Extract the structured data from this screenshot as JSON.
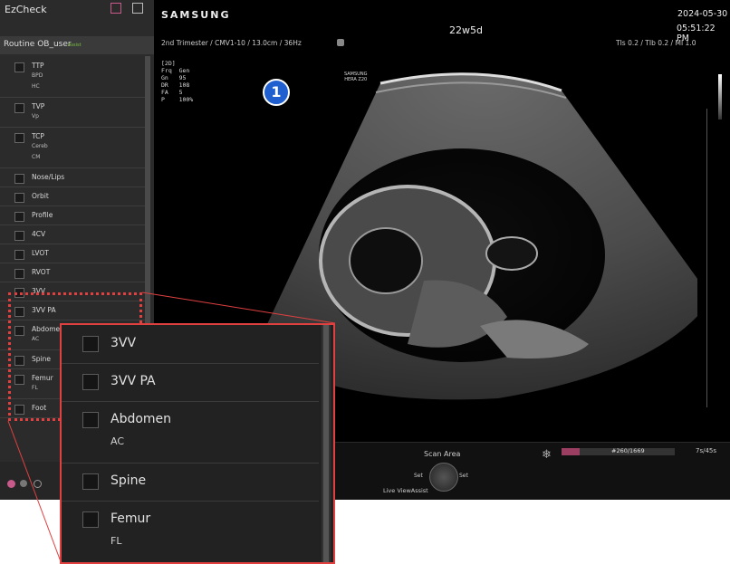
{
  "ezcheck": {
    "title": "EzCheck",
    "routine": "Routine OB_user",
    "routine_badge": "Assist",
    "items": [
      {
        "label": "TTP",
        "subs": [
          "BPD",
          "HC"
        ]
      },
      {
        "label": "TVP",
        "subs": [
          "Vp"
        ]
      },
      {
        "label": "TCP",
        "subs": [
          "Cereb",
          "CM"
        ]
      },
      {
        "label": "Nose/Lips",
        "subs": []
      },
      {
        "label": "Orbit",
        "subs": []
      },
      {
        "label": "Profile",
        "subs": []
      },
      {
        "label": "4CV",
        "subs": []
      },
      {
        "label": "LVOT",
        "subs": []
      },
      {
        "label": "RVOT",
        "subs": []
      },
      {
        "label": "3VV",
        "subs": []
      },
      {
        "label": "3VV PA",
        "subs": []
      },
      {
        "label": "Abdomen",
        "subs": [
          "AC"
        ]
      },
      {
        "label": "Spine",
        "subs": []
      },
      {
        "label": "Femur",
        "subs": [
          "FL"
        ]
      },
      {
        "label": "Foot",
        "subs": []
      }
    ]
  },
  "header": {
    "brand": "SAMSUNG",
    "ga": "22w5d",
    "date": "2024-05-30",
    "time": "05:51:22 PM",
    "preset": "2nd Trimester / CMV1-10 / 13.0cm / 36Hz",
    "indices": "TIs 0.2 / TIb 0.2 / MI 1.0"
  },
  "image_params": {
    "lines": [
      "[2D]",
      "Frq  Gen",
      "Gn   95",
      "DR   108",
      "FA   5",
      "P    100%"
    ],
    "watermark_line1": "SAMSUNG",
    "watermark_line2": "HERA Z20",
    "marker": "1"
  },
  "bottom": {
    "scan_area_title": "Scan Area",
    "set_left": "Set",
    "set_right": "Set",
    "live_label": "Live ViewAssist",
    "cine_frame": "#260/1669",
    "cine_time": "7s/45s"
  },
  "zoom": {
    "items": [
      {
        "label": "3VV",
        "subs": []
      },
      {
        "label": "3VV PA",
        "subs": []
      },
      {
        "label": "Abdomen",
        "subs": [
          "AC"
        ]
      },
      {
        "label": "Spine",
        "subs": []
      },
      {
        "label": "Femur",
        "subs": [
          "FL"
        ]
      }
    ]
  },
  "colors": {
    "highlight": "#e04040",
    "accent": "#c75a8a",
    "cine_bar": "#9c3e62"
  },
  "cine_progress": 0.156
}
